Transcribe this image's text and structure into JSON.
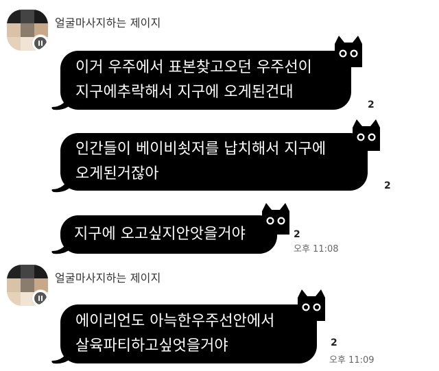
{
  "groups": [
    {
      "sender": "얼굴마사지하는 제이지",
      "messages": [
        {
          "lines": [
            "이거 우주에서 표본찾고오던 우주선이",
            "지구에추락해서 지구에 오게된건대"
          ],
          "unread": "2",
          "time": ""
        },
        {
          "lines": [
            "인간들이 베이비쇳저를 납치해서 지구에",
            "오게된거잖아"
          ],
          "unread": "2",
          "time": ""
        },
        {
          "lines": [
            "지구에 오고싶지안앗을거야"
          ],
          "unread": "2",
          "time": "오후 11:08"
        }
      ]
    },
    {
      "sender": "얼굴마사지하는 제이지",
      "messages": [
        {
          "lines": [
            "에이리언도 아늑한우주선안에서",
            "살육파티하고싶엇을거야"
          ],
          "unread": "2",
          "time": "오후 11:09"
        }
      ]
    }
  ],
  "colors": {
    "bubble": "#000000",
    "bubble_text": "#ffffff",
    "background": "#ffffff"
  },
  "icons": {
    "avatar_badge": "pause-icon",
    "bubble_decoration": "black-cat-icon"
  }
}
